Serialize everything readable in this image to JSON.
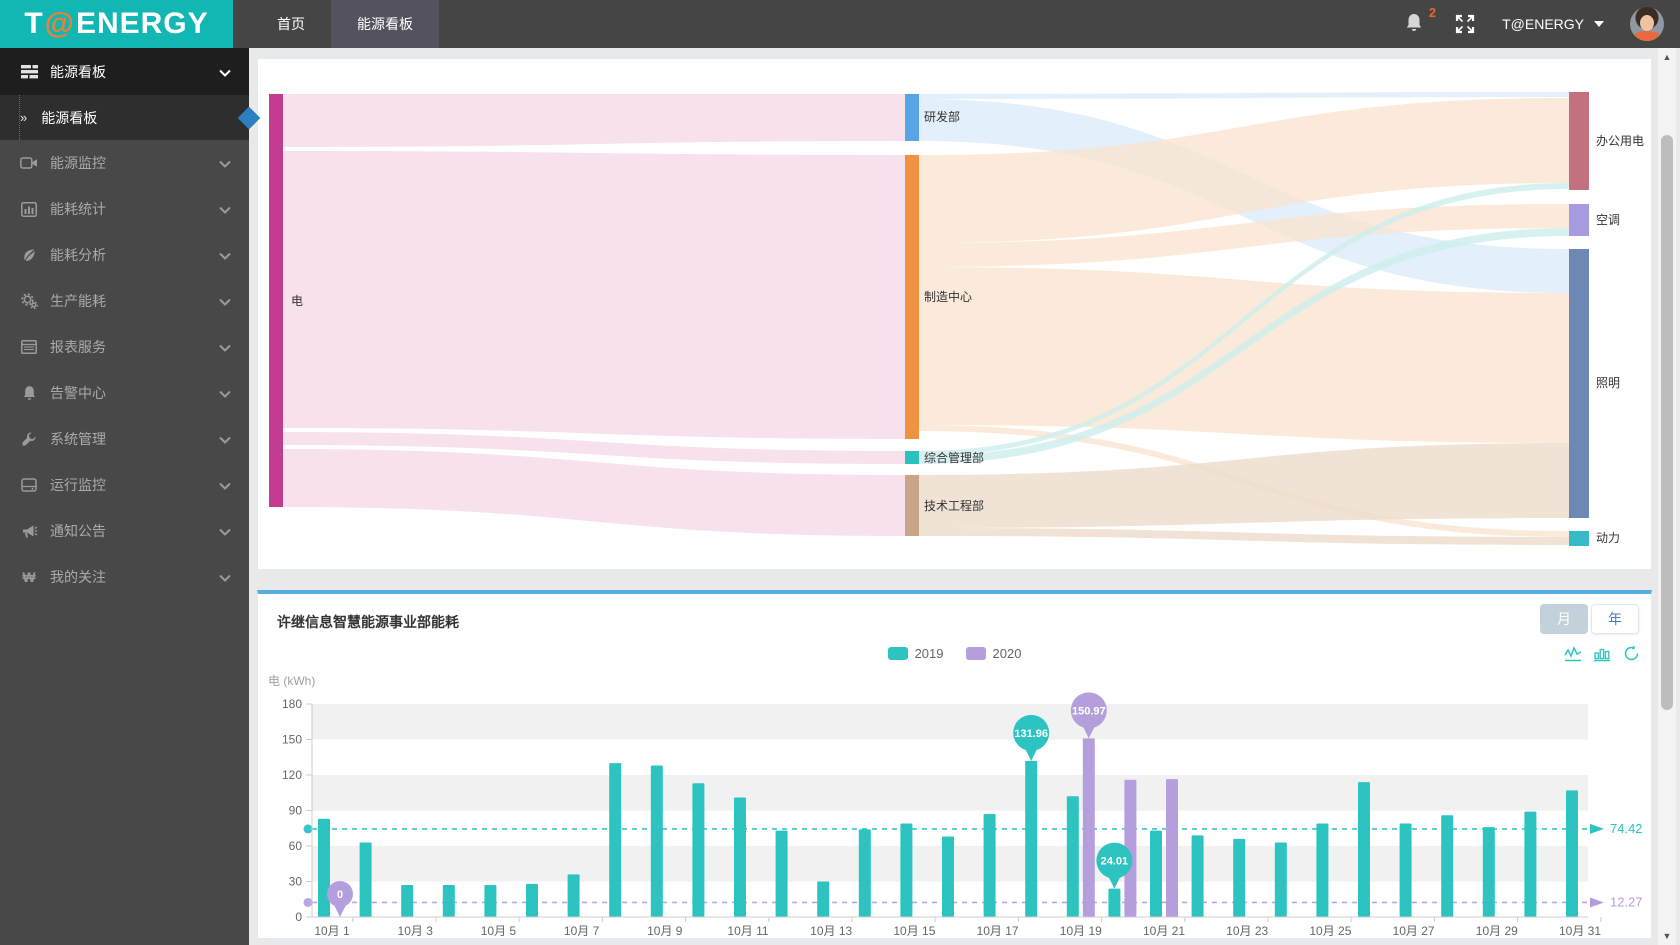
{
  "header": {
    "logo": {
      "t": "T",
      "at": "@",
      "rest": "ENERGY"
    },
    "nav": [
      {
        "label": "首页",
        "active": false
      },
      {
        "label": "能源看板",
        "active": true
      }
    ],
    "notification_badge": "2",
    "user_name": "T@ENERGY"
  },
  "sidebar": {
    "items": [
      {
        "label": "能源看板",
        "icon": "dashboard-icon",
        "expanded": true
      },
      {
        "label": "能源看板",
        "icon": "arrow-sub-icon",
        "active": true,
        "sub": true
      },
      {
        "label": "能源监控",
        "icon": "video-icon"
      },
      {
        "label": "能耗统计",
        "icon": "chart-icon"
      },
      {
        "label": "能耗分析",
        "icon": "leaf-icon"
      },
      {
        "label": "生产能耗",
        "icon": "gears-icon"
      },
      {
        "label": "报表服务",
        "icon": "report-icon"
      },
      {
        "label": "告警中心",
        "icon": "bell-icon"
      },
      {
        "label": "系统管理",
        "icon": "wrench-icon"
      },
      {
        "label": "运行监控",
        "icon": "drive-icon"
      },
      {
        "label": "通知公告",
        "icon": "announce-icon"
      },
      {
        "label": "我的关注",
        "icon": "follow-icon"
      }
    ]
  },
  "energy_panel": {
    "period_buttons": [
      {
        "label": "月",
        "active": true
      },
      {
        "label": "年",
        "active": false
      }
    ]
  },
  "chart_data": [
    {
      "type": "sankey",
      "nodes": [
        {
          "name": "电",
          "color": "#c23d90",
          "level": 0
        },
        {
          "name": "研发部",
          "color": "#58a4e4",
          "level": 1
        },
        {
          "name": "制造中心",
          "color": "#ef9242",
          "level": 1
        },
        {
          "name": "综合管理部",
          "color": "#2bc2bd",
          "level": 1
        },
        {
          "name": "技术工程部",
          "color": "#c8a488",
          "level": 1
        },
        {
          "name": "办公用电",
          "color": "#c4717f",
          "level": 2
        },
        {
          "name": "空调",
          "color": "#a89ade",
          "level": 2
        },
        {
          "name": "照明",
          "color": "#6e88b5",
          "level": 2
        },
        {
          "name": "动力",
          "color": "#38b9c6",
          "level": 2
        }
      ],
      "links": [
        {
          "source": "电",
          "target": "研发部",
          "value": 53
        },
        {
          "source": "电",
          "target": "制造中心",
          "value": 277
        },
        {
          "source": "电",
          "target": "综合管理部",
          "value": 13
        },
        {
          "source": "电",
          "target": "技术工程部",
          "value": 58
        },
        {
          "source": "研发部",
          "target": "办公用电",
          "value": 5
        },
        {
          "source": "研发部",
          "target": "照明",
          "value": 44
        },
        {
          "source": "制造中心",
          "target": "办公用电",
          "value": 85
        },
        {
          "source": "制造中心",
          "target": "空调",
          "value": 24
        },
        {
          "source": "制造中心",
          "target": "照明",
          "value": 150
        },
        {
          "source": "制造中心",
          "target": "动力",
          "value": 6
        },
        {
          "source": "综合管理部",
          "target": "办公用电",
          "value": 6
        },
        {
          "source": "综合管理部",
          "target": "空调",
          "value": 7
        },
        {
          "source": "技术工程部",
          "target": "照明",
          "value": 50
        },
        {
          "source": "技术工程部",
          "target": "动力",
          "value": 8
        }
      ]
    },
    {
      "type": "bar",
      "title": "许继信息智慧能源事业部能耗",
      "ylabel": "电 (kWh)",
      "ylim": [
        0,
        180
      ],
      "y_ticks": [
        0,
        30,
        60,
        90,
        120,
        150,
        180
      ],
      "categories": [
        "10月 1",
        "10月 2",
        "10月 3",
        "10月 4",
        "10月 5",
        "10月 6",
        "10月 7",
        "10月 8",
        "10月 9",
        "10月 10",
        "10月 11",
        "10月 12",
        "10月 13",
        "10月 14",
        "10月 15",
        "10月 16",
        "10月 17",
        "10月 18",
        "10月 19",
        "10月 20",
        "10月 21",
        "10月 22",
        "10月 23",
        "10月 24",
        "10月 25",
        "10月 26",
        "10月 27",
        "10月 28",
        "10月 29",
        "10月 30",
        "10月 31"
      ],
      "x_tick_labels": [
        "10月 1",
        "10月 3",
        "10月 5",
        "10月 7",
        "10月 9",
        "10月 11",
        "10月 13",
        "10月 15",
        "10月 17",
        "10月 19",
        "10月 21",
        "10月 23",
        "10月 25",
        "10月 27",
        "10月 29",
        "10月 31"
      ],
      "series": [
        {
          "name": "2019",
          "color": "#2cc3c0",
          "values": [
            83,
            63,
            27,
            27,
            27,
            28,
            36,
            130,
            128,
            113,
            101,
            73,
            30,
            74,
            79,
            68,
            87,
            131.96,
            102,
            24.01,
            73,
            69,
            66,
            63,
            79,
            114,
            79,
            86,
            76,
            89,
            107
          ],
          "average": 74.42
        },
        {
          "name": "2020",
          "color": "#b49fdc",
          "values": [
            0,
            0,
            0,
            0,
            0,
            0,
            0,
            0,
            0,
            0,
            0,
            0,
            0,
            0,
            0,
            0,
            0,
            0,
            150.97,
            116,
            116.5,
            0,
            0,
            0,
            0,
            0,
            0,
            0,
            0,
            0,
            0
          ],
          "average": 12.27
        }
      ],
      "average_labels": [
        "74.42",
        "12.27"
      ],
      "mark_points": [
        {
          "series": "2019",
          "index": 17,
          "label": "131.96"
        },
        {
          "series": "2020",
          "index": 18,
          "label": "150.97"
        },
        {
          "series": "2019",
          "index": 19,
          "label": "24.01"
        },
        {
          "series": "2020",
          "index": 0,
          "label": "0"
        }
      ],
      "legend_position": "top-center",
      "grid": "striped-bands"
    }
  ]
}
